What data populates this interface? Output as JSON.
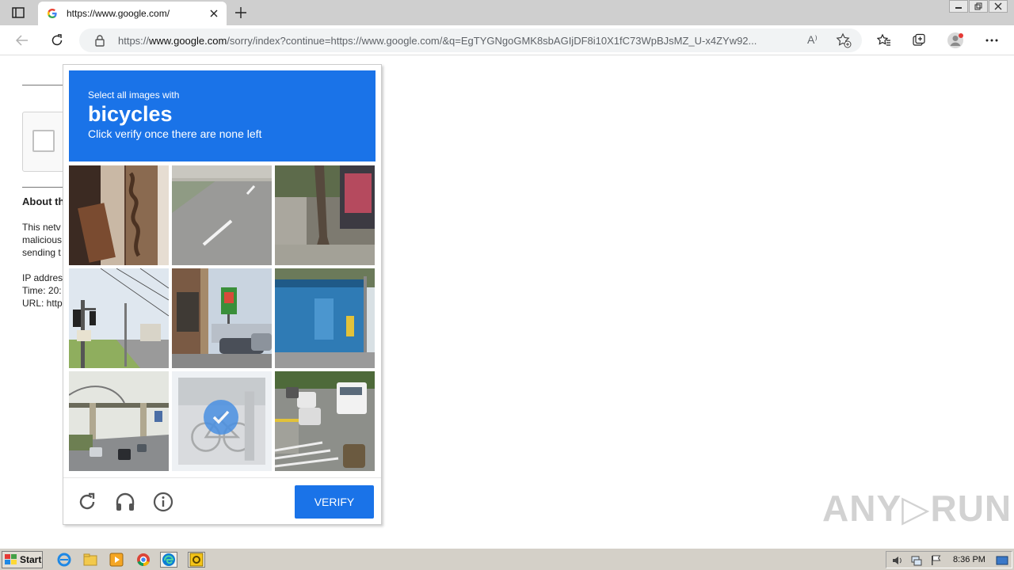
{
  "browser": {
    "tab_title": "https://www.google.com/",
    "url_prefix": "https://",
    "url_host": "www.google.com",
    "url_rest": "/sorry/index?continue=https://www.google.com/&q=EgTYGNgoGMK8sbAGIjDF8i10X1fC73WpBJsMZ_U-x4ZYw92...",
    "read_aloud_glyph": "A⁾"
  },
  "page": {
    "about_title": "About th",
    "about_lines": [
      "This netv",
      "malicious",
      "sending t"
    ],
    "meta_lines": [
      "IP addres",
      "Time: 20:",
      "URL: http"
    ]
  },
  "captcha": {
    "instruction_small": "Select all images with",
    "instruction_target": "bicycles",
    "instruction_sub": "Click verify once there are none left",
    "verify_label": "VERIFY",
    "tiles": [
      {
        "selected": false
      },
      {
        "selected": false
      },
      {
        "selected": false
      },
      {
        "selected": false
      },
      {
        "selected": false
      },
      {
        "selected": false
      },
      {
        "selected": false
      },
      {
        "selected": true
      },
      {
        "selected": false
      }
    ]
  },
  "watermark": "ANY▷RUN",
  "taskbar": {
    "start_label": "Start",
    "clock": "8:36 PM"
  },
  "colors": {
    "accent": "#1a73e8",
    "check": "#4a90e2"
  }
}
